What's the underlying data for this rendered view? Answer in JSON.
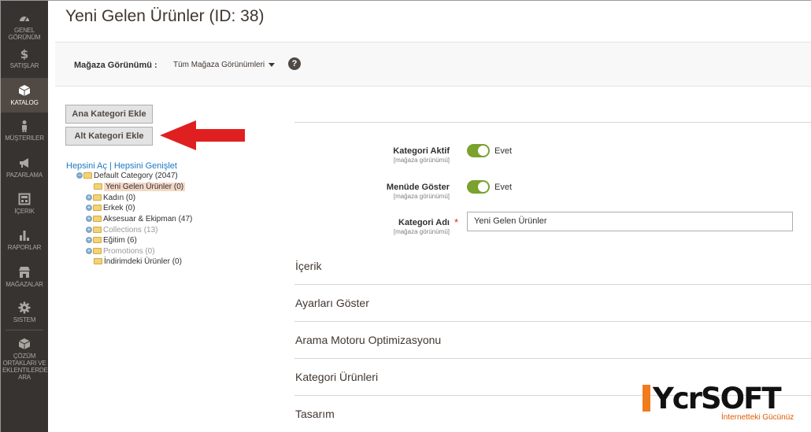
{
  "sidebar": {
    "items": [
      {
        "label": "GENEL GÖRÜNÜM",
        "icon": "dashboard-icon"
      },
      {
        "label": "SATIŞLAR",
        "icon": "dollar-icon"
      },
      {
        "label": "KATALOG",
        "icon": "cube-icon"
      },
      {
        "label": "MÜŞTERILER",
        "icon": "person-icon"
      },
      {
        "label": "PAZARLAMA",
        "icon": "megaphone-icon"
      },
      {
        "label": "İÇERIK",
        "icon": "layout-icon"
      },
      {
        "label": "RAPORLAR",
        "icon": "bar-chart-icon"
      },
      {
        "label": "MAĞAZALAR",
        "icon": "store-icon"
      },
      {
        "label": "SISTEM",
        "icon": "gear-icon"
      },
      {
        "label": "ÇÖZÜM ORTAKLARI VE EKLENTILERDE ARA",
        "icon": "extensions-icon"
      }
    ],
    "active": "KATALOG"
  },
  "page": {
    "title": "Yeni Gelen Ürünler (ID: 38)"
  },
  "store": {
    "label": "Mağaza Görünümü :",
    "value": "Tüm Mağaza Görünümleri",
    "help": "?"
  },
  "buttons": {
    "add_root": "Ana Kategori Ekle",
    "add_sub": "Alt Kategori Ekle"
  },
  "tree": {
    "expand_all": "Hepsini Aç",
    "separator": "|",
    "collapse_all": "Hepsini Genişlet",
    "nodes": [
      {
        "label": "Default Category (2047)"
      },
      {
        "label": "Yeni Gelen Ürünler (0)"
      },
      {
        "label": "Kadın (0)"
      },
      {
        "label": "Erkek (0)"
      },
      {
        "label": "Aksesuar & Ekipman (47)"
      },
      {
        "label": "Collections (13)"
      },
      {
        "label": "Eğitim (6)"
      },
      {
        "label": "Promotions (0)"
      },
      {
        "label": "İndirimdeki Ürünler (0)"
      }
    ]
  },
  "form": {
    "active": {
      "label": "Kategori Aktif",
      "scope": "[mağaza görünümü]",
      "value": "Evet"
    },
    "menu": {
      "label": "Menüde Göster",
      "scope": "[mağaza görünümü]",
      "value": "Evet"
    },
    "name": {
      "label": "Kategori Adı",
      "scope": "[mağaza görünümü]",
      "required": "*",
      "value": "Yeni Gelen Ürünler"
    }
  },
  "sections": [
    "İçerik",
    "Ayarları Göster",
    "Arama Motoru Optimizasyonu",
    "Kategori Ürünleri",
    "Tasarım"
  ],
  "brand": {
    "logo": "YcrSOFT",
    "slogan": "İnternetteki Gücünüz",
    "accent": "#f07c1e"
  },
  "colors": {
    "sidebar": "#373330",
    "toggle_on": "#79a22e",
    "arrow": "#e02020",
    "link": "#1979c3"
  }
}
